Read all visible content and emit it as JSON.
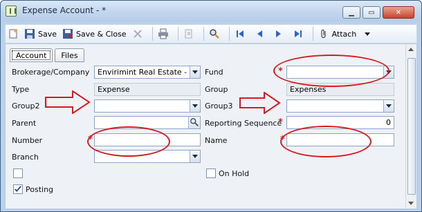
{
  "window": {
    "title": "Expense Account - *",
    "min": "▁",
    "max": "▭",
    "close": "✕"
  },
  "toolbar": {
    "save": "Save",
    "save_close": "Save & Close",
    "attach": "Attach"
  },
  "tabs": [
    "Account",
    "Files"
  ],
  "form": {
    "brokerage_label": "Brokerage/Company",
    "brokerage_value": "Envirimint Real Estate - ...",
    "fund_label": "Fund",
    "fund_value": "",
    "type_label": "Type",
    "type_value": "Expense",
    "group_label": "Group",
    "group_value": "Expenses",
    "group2_label": "Group2",
    "group2_value": "",
    "group3_label": "Group3",
    "group3_value": "",
    "parent_label": "Parent",
    "parent_value": "",
    "reporting_label": "Reporting Sequence",
    "reporting_value": "0",
    "number_label": "Number",
    "number_value": "",
    "name_label": "Name",
    "name_value": "",
    "branch_label": "Branch",
    "branch_value": "",
    "onhold_label": "On Hold",
    "posting_label": "Posting",
    "required_mark": "*"
  },
  "colors": {
    "annotation": "#d9191f",
    "accent": "#3f5e84"
  }
}
